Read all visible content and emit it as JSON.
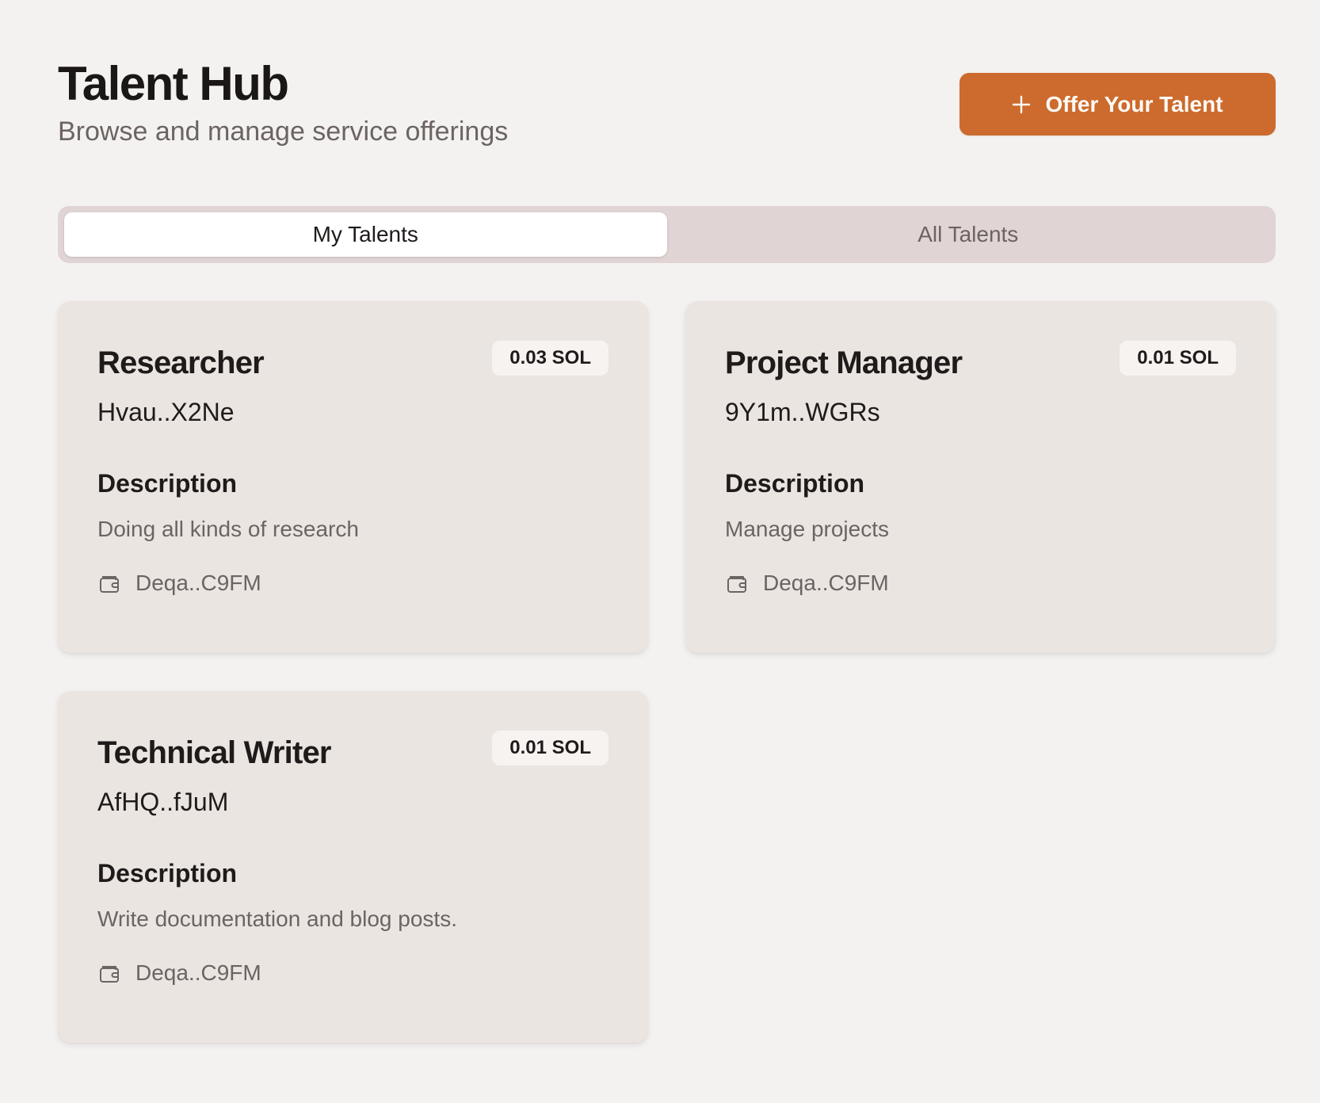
{
  "header": {
    "title": "Talent Hub",
    "subtitle": "Browse and manage service offerings",
    "offer_button": {
      "label": "Offer Your Talent",
      "icon": "plus-icon",
      "color": "#cc6b2d"
    }
  },
  "tabs": [
    {
      "label": "My Talents",
      "active": true
    },
    {
      "label": "All Talents",
      "active": false
    }
  ],
  "cards": [
    {
      "title": "Researcher",
      "price": "0.03 SOL",
      "address": "Hvau..X2Ne",
      "description_label": "Description",
      "description": "Doing all kinds of research",
      "owner_icon": "wallet-icon",
      "owner": "Deqa..C9FM"
    },
    {
      "title": "Project Manager",
      "price": "0.01 SOL",
      "address": "9Y1m..WGRs",
      "description_label": "Description",
      "description": "Manage projects",
      "owner_icon": "wallet-icon",
      "owner": "Deqa..C9FM"
    },
    {
      "title": "Technical Writer",
      "price": "0.01 SOL",
      "address": "AfHQ..fJuM",
      "description_label": "Description",
      "description": "Write documentation and blog posts.",
      "owner_icon": "wallet-icon",
      "owner": "Deqa..C9FM"
    }
  ]
}
